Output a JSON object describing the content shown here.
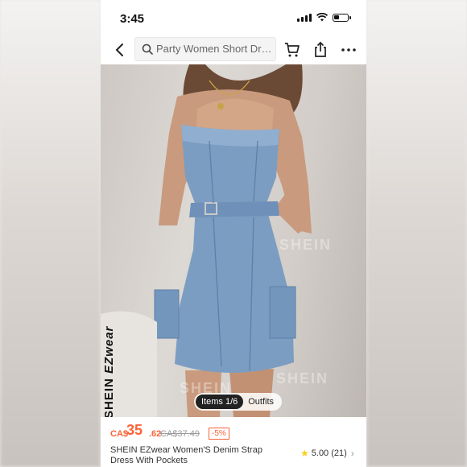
{
  "status_bar": {
    "time": "3:45"
  },
  "nav": {
    "search_placeholder": "Party Women Short Dre..."
  },
  "brand": {
    "prefix": "SHEIN ",
    "suffix": "EZwear"
  },
  "image_pills": {
    "active": "Items 1/6",
    "inactive": "Outfits"
  },
  "watermark": "SHEIN",
  "price": {
    "currency": "CA$",
    "main": "35",
    "cents": ".62",
    "original": "CA$37.49",
    "discount": "-5%"
  },
  "product": {
    "title": "SHEIN EZwear Women'S Denim Strap Dress With Pockets",
    "rating": "5.00",
    "review_count": "(21)"
  },
  "colors": {
    "accent": "#fa6338",
    "star": "#facf19"
  }
}
